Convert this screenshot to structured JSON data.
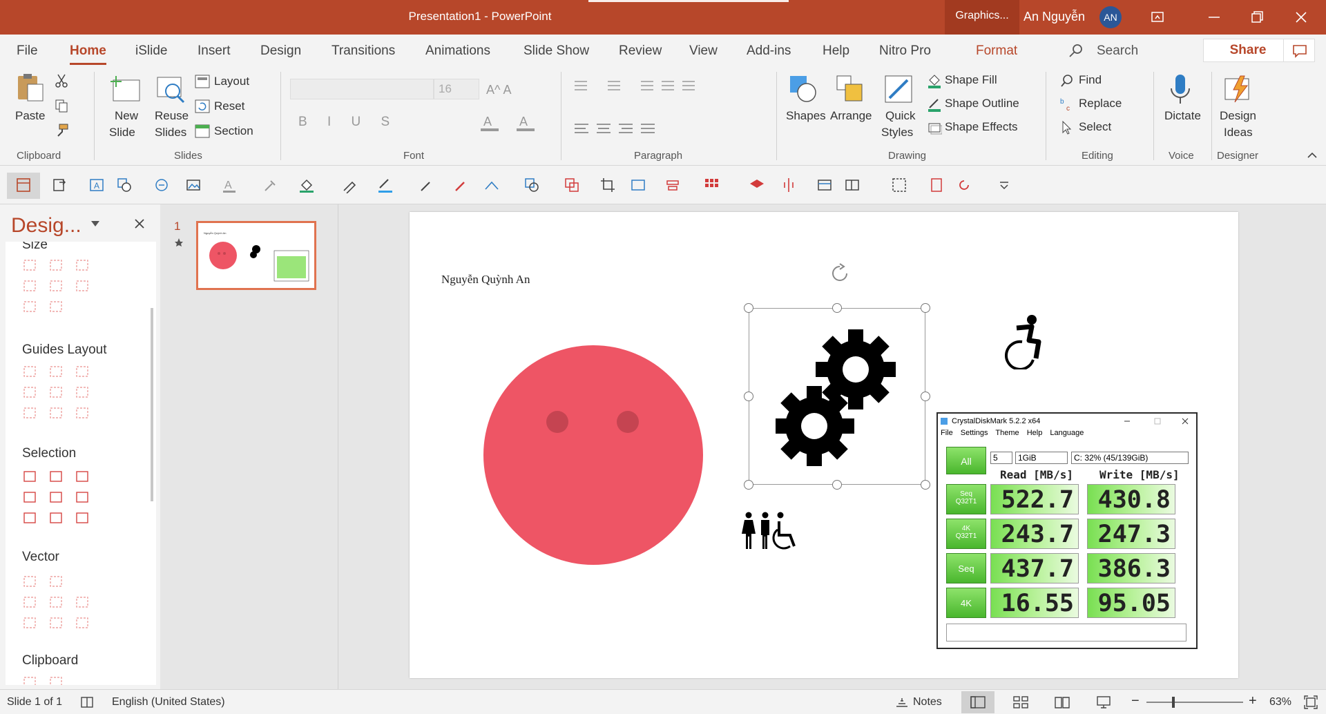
{
  "window": {
    "title": "Presentation1  -  PowerPoint",
    "context_tab": "Graphics...",
    "user_name": "An Nguyễn",
    "user_initials": "AN"
  },
  "tabs": [
    "File",
    "Home",
    "iSlide",
    "Insert",
    "Design",
    "Transitions",
    "Animations",
    "Slide Show",
    "Review",
    "View",
    "Add-ins",
    "Help",
    "Nitro Pro",
    "Format"
  ],
  "active_tab": "Home",
  "search_label": "Search",
  "share_label": "Share",
  "ribbon": {
    "clipboard": {
      "label": "Clipboard",
      "paste": "Paste"
    },
    "slides": {
      "label": "Slides",
      "new_slide_1": "New",
      "new_slide_2": "Slide",
      "reuse_1": "Reuse",
      "reuse_2": "Slides",
      "layout": "Layout",
      "reset": "Reset",
      "section": "Section"
    },
    "font": {
      "label": "Font",
      "size": "16"
    },
    "paragraph": {
      "label": "Paragraph"
    },
    "drawing": {
      "label": "Drawing",
      "shapes": "Shapes",
      "arrange": "Arrange",
      "quick_1": "Quick",
      "quick_2": "Styles",
      "fill": "Shape Fill",
      "outline": "Shape Outline",
      "effects": "Shape Effects"
    },
    "editing": {
      "label": "Editing",
      "find": "Find",
      "replace": "Replace",
      "select": "Select"
    },
    "voice": {
      "label": "Voice",
      "dictate": "Dictate"
    },
    "designer": {
      "label": "Designer",
      "ideas_1": "Design",
      "ideas_2": "Ideas"
    }
  },
  "pane": {
    "title": "Desig...",
    "sections": [
      "Size",
      "Guides Layout",
      "Selection",
      "Vector",
      "Clipboard"
    ]
  },
  "thumbnail": {
    "number": "1"
  },
  "slide": {
    "author_text": "Nguyễn Quỳnh An"
  },
  "crystal": {
    "title": "CrystalDiskMark 5.2.2 x64",
    "menu": [
      "File",
      "Settings",
      "Theme",
      "Help",
      "Language"
    ],
    "all_label": "All",
    "count": "5",
    "size": "1GiB",
    "drive": "C: 32% (45/139GiB)",
    "read_header": "Read [MB/s]",
    "write_header": "Write [MB/s]",
    "rows": [
      {
        "label_1": "Seq",
        "label_2": "Q32T1",
        "read": "522.7",
        "write": "430.8"
      },
      {
        "label_1": "4K",
        "label_2": "Q32T1",
        "read": "243.7",
        "write": "247.3"
      },
      {
        "label_1": "Seq",
        "label_2": "",
        "read": "437.7",
        "write": "386.3"
      },
      {
        "label_1": "4K",
        "label_2": "",
        "read": "16.55",
        "write": "95.05"
      }
    ]
  },
  "status": {
    "slide_info": "Slide 1 of 1",
    "language": "English (United States)",
    "notes": "Notes",
    "zoom": "63%"
  },
  "colors": {
    "accent": "#b7472a",
    "face": "#ee5565",
    "eyes": "#c54451"
  }
}
